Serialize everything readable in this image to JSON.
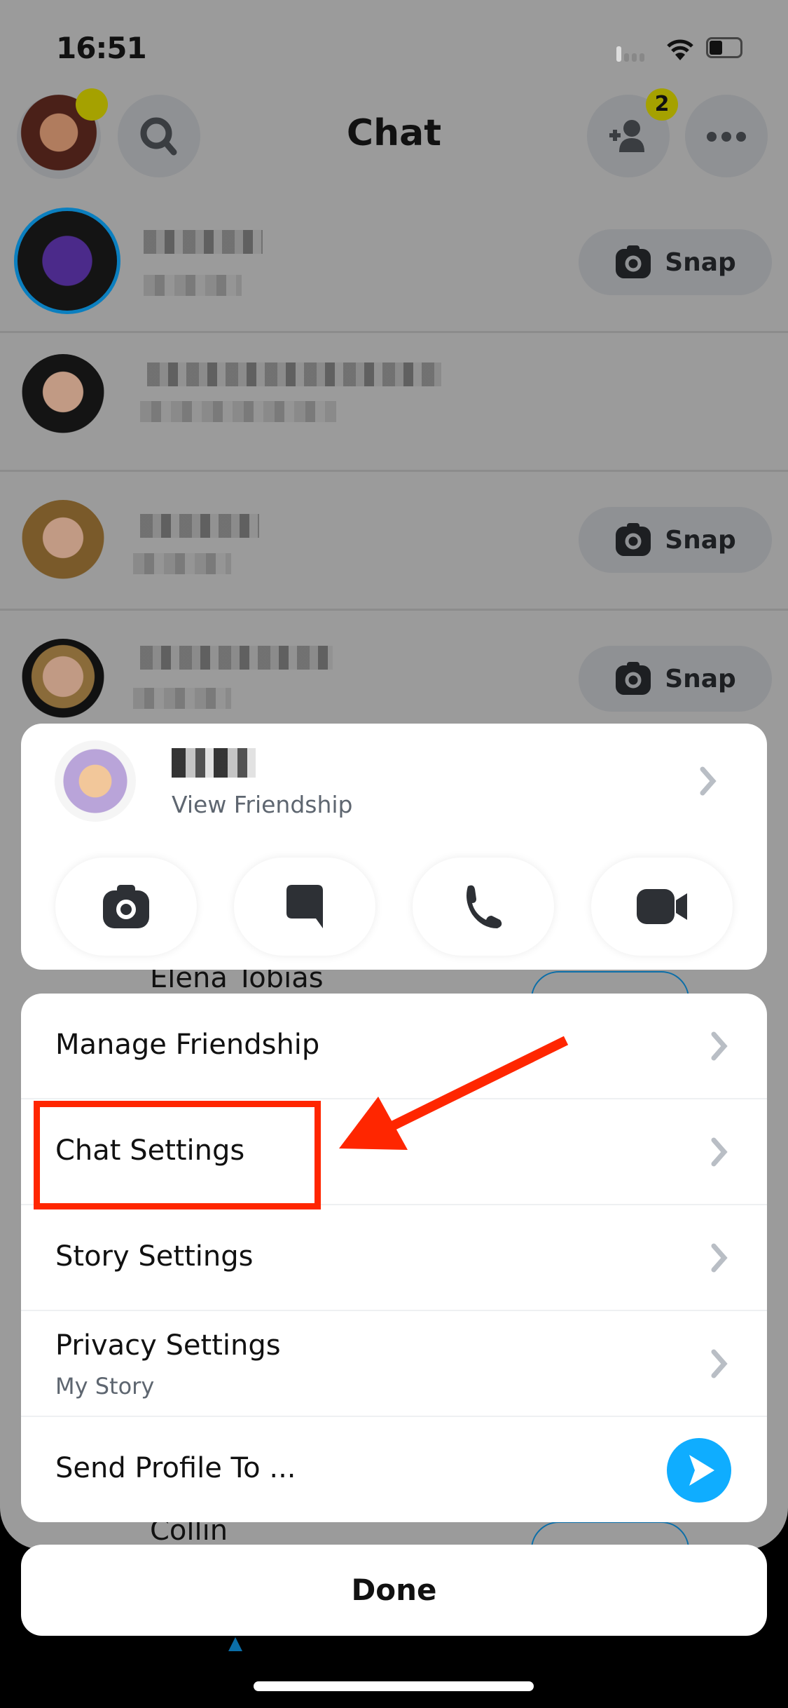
{
  "status_bar": {
    "time": "16:51"
  },
  "header": {
    "title": "Chat",
    "add_friend_badge": "2"
  },
  "chat_list": {
    "snap_label": "Snap",
    "rows": [
      {
        "has_snap_button": true,
        "story_ring": true
      },
      {
        "has_snap_button": false
      },
      {
        "has_snap_button": true
      },
      {
        "has_snap_button": true
      }
    ],
    "partially_visible": [
      "Elena Tobias",
      "Collin"
    ]
  },
  "profile_card": {
    "subtitle": "View Friendship",
    "actions": [
      "camera-icon",
      "chat-bubble-icon",
      "phone-icon",
      "video-camera-icon"
    ]
  },
  "menu": {
    "items": [
      {
        "label": "Manage Friendship"
      },
      {
        "label": "Chat Settings",
        "highlighted": true
      },
      {
        "label": "Story Settings"
      },
      {
        "label": "Privacy Settings",
        "sublabel": "My Story"
      },
      {
        "label": "Send Profile To ..."
      }
    ]
  },
  "done_label": "Done",
  "colors": {
    "highlight": "#ff2600",
    "send_button": "#0fadff",
    "badge": "#a5a100"
  }
}
